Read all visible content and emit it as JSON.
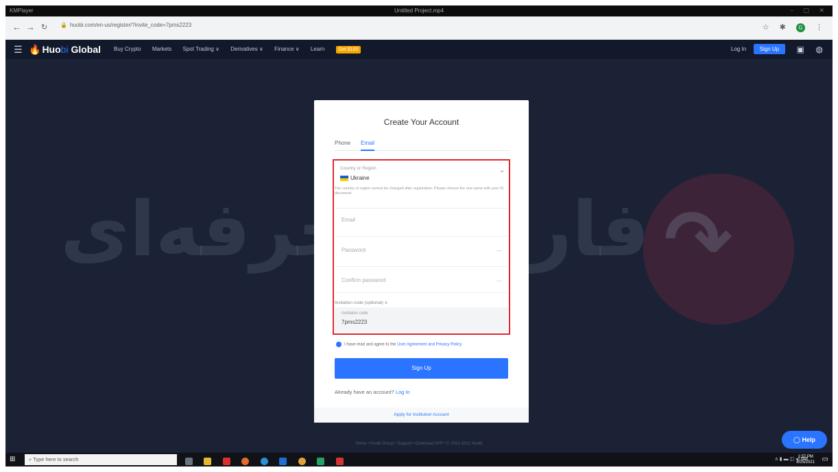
{
  "player": {
    "app_name": "KMPlayer",
    "file_name": "Untitled Project.mp4"
  },
  "browser": {
    "url": "huobi.com/en-us/register/?invite_code=7pms2223"
  },
  "site": {
    "logo_main": "Huo",
    "logo_accent": "bi",
    "logo_tail": " Global",
    "nav": [
      "Buy Crypto",
      "Markets",
      "Spot Trading ∨",
      "Derivatives ∨",
      "Finance ∨",
      "Learn"
    ],
    "nav_badge": "Get $100",
    "login": "Log In",
    "signup": "Sign Up"
  },
  "watermark": {
    "text": "فارکس حرفه‌ای"
  },
  "form": {
    "title": "Create Your Account",
    "tabs": [
      "Phone",
      "Email"
    ],
    "country_label": "Country or Region",
    "country_value": "Ukraine",
    "country_note": "The country or region cannot be changed after registration. Please choose the one same with your ID document.",
    "email_placeholder": "Email",
    "password_placeholder": "Password",
    "confirm_placeholder": "Confirm password",
    "invite_toggle": "Invitation code (optional) ∧",
    "invite_label": "Invitation code",
    "invite_value": "7pms2223",
    "agree_text": "I have read and agree to the ",
    "agree_link": "User Agreement and Privacy Policy",
    "signup_button": "Sign Up",
    "already_text": "Already have an account? ",
    "already_link": "Log In",
    "institution_link": "Apply for Institution Account"
  },
  "footer": {
    "links": "Home  •  Huobi Group  •  Support  •  Download APP  •  © 2013-2021 Huobi"
  },
  "help_button": "Help",
  "taskbar": {
    "search_placeholder": "Type here to search",
    "time": "1:37 PM",
    "date": "8/25/2021"
  },
  "colors": {
    "accent": "#2a74ff",
    "highlight": "#e3262e",
    "badge": "#f7a600"
  }
}
